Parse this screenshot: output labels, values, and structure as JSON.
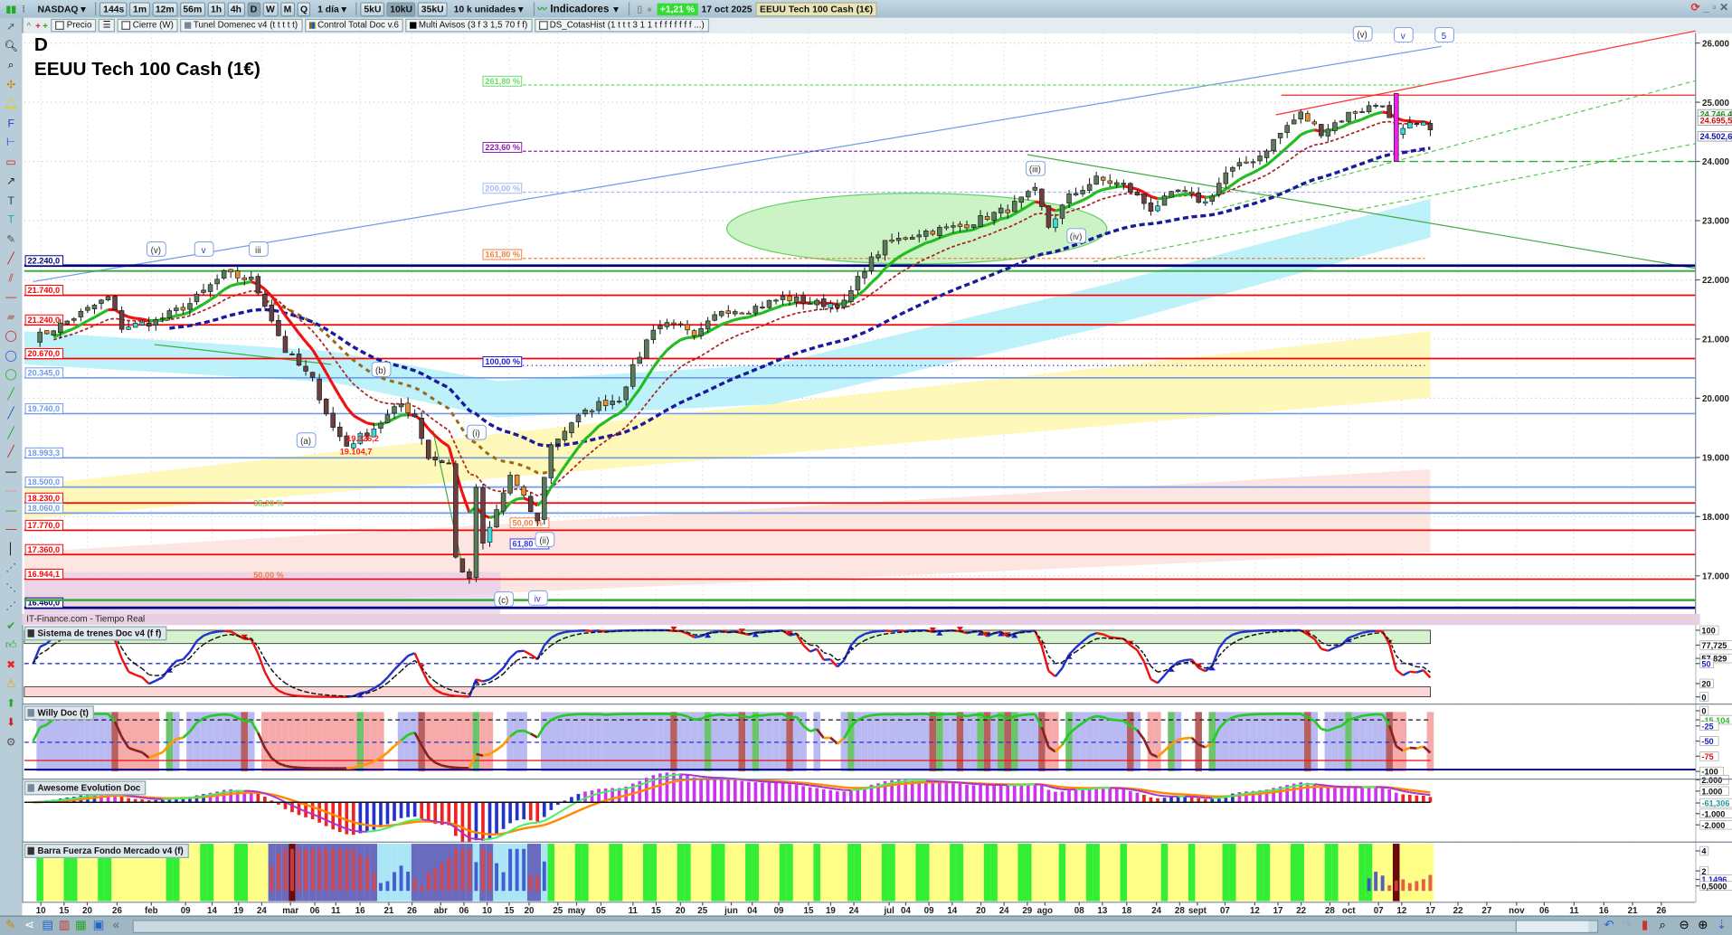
{
  "toolbar": {
    "market": "NASDAQ",
    "timeframes": [
      "144s",
      "1m",
      "12m",
      "56m",
      "1h",
      "4h",
      "D",
      "W",
      "M",
      "Q"
    ],
    "active_timeframe": "D",
    "period": "1 día",
    "units": [
      "5kU",
      "10kU",
      "35kU"
    ],
    "active_unit": "10kU",
    "unit_select": "10 k unidades",
    "indicators_label": "Indicadores",
    "change": "+1,21 %",
    "date": "17 oct 2025",
    "instrument": "EEUU Tech 100 Cash (1€)"
  },
  "indicator_bar": [
    "Precio",
    "Cierre (W)",
    "Tunel Domenec v4 (t t t t t)",
    "Control Total Doc v.6",
    "Multi Avisos (3 f 3 1,5 70 f f)",
    "DS_CotasHist (1 t t t 3 1 1 t f f f f f f f ...)"
  ],
  "chart": {
    "period_letter": "D",
    "title": "EEUU Tech 100 Cash (1€)",
    "source": "IT-Finance.com - Tiempo Real",
    "price_axis": [
      "26.000",
      "25.000",
      "24.000",
      "23.000",
      "22.000",
      "21.000",
      "20.000",
      "19.000",
      "18.000",
      "17.000"
    ],
    "price_axis_values": [
      26000,
      25000,
      24000,
      23000,
      22000,
      21000,
      20000,
      19000,
      18000,
      17000
    ],
    "current_prices": [
      {
        "text": "24.746,4",
        "price": 24746,
        "color": "#1a8a1a"
      },
      {
        "text": "24.695,5",
        "price": 24695,
        "color": "#d01010"
      },
      {
        "text": "24.502,6",
        "price": 24502,
        "color": "#1010b0"
      }
    ],
    "levels": [
      {
        "text": "22.240,0",
        "price": 22240,
        "color": "#000080"
      },
      {
        "text": "21.740,0",
        "price": 21740,
        "color": "#ff0000"
      },
      {
        "text": "21.240,0",
        "price": 21240,
        "color": "#ff0000"
      },
      {
        "text": "20.670,0",
        "price": 20670,
        "color": "#ff0000"
      },
      {
        "text": "20.345,0",
        "price": 20345,
        "color": "#6f9be8"
      },
      {
        "text": "19.740,0",
        "price": 19740,
        "color": "#6f9be8"
      },
      {
        "text": "18.993,3",
        "price": 18993,
        "color": "#6f9be8"
      },
      {
        "text": "18.500,0",
        "price": 18500,
        "color": "#6f9be8"
      },
      {
        "text": "18.230,0",
        "price": 18230,
        "color": "#ff0000"
      },
      {
        "text": "18.060,0",
        "price": 18060,
        "color": "#6f9be8"
      },
      {
        "text": "17.770,0",
        "price": 17770,
        "color": "#ff0000"
      },
      {
        "text": "17.360,0",
        "price": 17360,
        "color": "#ff0000"
      },
      {
        "text": "16.944,1",
        "price": 16944,
        "color": "#ff0000"
      },
      {
        "text": "16.460,0",
        "price": 16460,
        "color": "#000080"
      }
    ],
    "fib_labels": [
      {
        "text": "261,80 %",
        "day": 66,
        "price": 25347,
        "color": "#66dd66"
      },
      {
        "text": "223,60 %",
        "day": 66,
        "price": 24228,
        "color": "#8a20b0"
      },
      {
        "text": "200,00 %",
        "day": 66,
        "price": 23537,
        "color": "#a8b8f0"
      },
      {
        "text": "161,80 %",
        "day": 66,
        "price": 22418,
        "color": "#f08040"
      },
      {
        "text": "100,00 %",
        "day": 66,
        "price": 20608,
        "color": "#1a1ae0"
      },
      {
        "text": "50,00 %",
        "day": 70,
        "price": 17884,
        "color": "#f08040"
      },
      {
        "text": "61,80 %",
        "day": 70,
        "price": 17530,
        "color": "#3a3ae0"
      },
      {
        "text": "38,20 %",
        "day": 32,
        "price": 18220,
        "color": "#88cc66"
      },
      {
        "text": "50,00 %",
        "day": 32,
        "price": 17007,
        "color": "#f08040"
      }
    ],
    "price_notes": [
      {
        "text": "19.326,2",
        "day": 46,
        "price": 19326,
        "color": "#ff2020"
      },
      {
        "text": "19.104,7",
        "day": 45,
        "price": 19104,
        "color": "#ff2020"
      }
    ],
    "wave_labels": [
      {
        "text": "(v)",
        "day": 18,
        "price": 22510
      },
      {
        "text": "v",
        "day": 25,
        "price": 22510
      },
      {
        "text": "iii",
        "day": 33,
        "price": 22510
      },
      {
        "text": "(a)",
        "day": 40,
        "price": 19284
      },
      {
        "text": "(b)",
        "day": 51,
        "price": 20478
      },
      {
        "text": "(i)",
        "day": 65,
        "price": 19414
      },
      {
        "text": "(ii)",
        "day": 75,
        "price": 17604
      },
      {
        "text": "(c)",
        "day": 69,
        "price": 16597
      },
      {
        "text": "iv",
        "day": 74,
        "price": 16616
      },
      {
        "text": "(iii)",
        "day": 147,
        "price": 23873
      },
      {
        "text": "(iv)",
        "day": 153,
        "price": 22735
      },
      {
        "text": "(v)",
        "day": 195,
        "price": 26149
      },
      {
        "text": "v",
        "day": 201,
        "price": 26130
      },
      {
        "text": "5",
        "day": 207,
        "price": 26130
      }
    ],
    "price_path": [
      [
        0,
        21000
      ],
      [
        5,
        21300
      ],
      [
        11,
        21700
      ],
      [
        13,
        21200
      ],
      [
        18,
        21300
      ],
      [
        23,
        21600
      ],
      [
        28,
        22100
      ],
      [
        32,
        22000
      ],
      [
        34,
        21600
      ],
      [
        37,
        20800
      ],
      [
        41,
        20300
      ],
      [
        44,
        19500
      ],
      [
        46,
        19200
      ],
      [
        50,
        19500
      ],
      [
        54,
        19900
      ],
      [
        56,
        19700
      ],
      [
        58,
        19000
      ],
      [
        61,
        18900
      ],
      [
        62,
        17300
      ],
      [
        64,
        16900
      ],
      [
        65,
        18500
      ],
      [
        66,
        17500
      ],
      [
        70,
        18700
      ],
      [
        72,
        18300
      ],
      [
        74,
        17900
      ],
      [
        75,
        18700
      ],
      [
        76,
        19200
      ],
      [
        79,
        19600
      ],
      [
        83,
        19900
      ],
      [
        86,
        20000
      ],
      [
        88,
        20500
      ],
      [
        91,
        21200
      ],
      [
        94,
        21300
      ],
      [
        97,
        21000
      ],
      [
        101,
        21500
      ],
      [
        105,
        21500
      ],
      [
        110,
        21700
      ],
      [
        115,
        21600
      ],
      [
        119,
        21600
      ],
      [
        122,
        22200
      ],
      [
        125,
        22600
      ],
      [
        130,
        22800
      ],
      [
        136,
        22900
      ],
      [
        143,
        23200
      ],
      [
        147,
        23500
      ],
      [
        149,
        22900
      ],
      [
        152,
        23400
      ],
      [
        156,
        23700
      ],
      [
        160,
        23600
      ],
      [
        164,
        23200
      ],
      [
        168,
        23500
      ],
      [
        172,
        23300
      ],
      [
        175,
        23800
      ],
      [
        180,
        24100
      ],
      [
        184,
        24600
      ],
      [
        186,
        24800
      ],
      [
        189,
        24500
      ],
      [
        193,
        24800
      ],
      [
        198,
        25000
      ],
      [
        200,
        24400
      ],
      [
        202,
        24600
      ],
      [
        205,
        24600
      ]
    ]
  },
  "panes": [
    {
      "title": "Sistema de trenes Doc v4 (f f)",
      "axis": [
        "100",
        "77,725",
        "57,829",
        "50",
        "20",
        "0"
      ],
      "axis_values": [
        100,
        77.7,
        57.8,
        50,
        20,
        0
      ]
    },
    {
      "title": "Willy Doc (t)",
      "axis": [
        "0",
        "-15,104",
        "-25",
        "-50",
        "-75",
        "-100"
      ],
      "axis_values": [
        0,
        -15,
        -25,
        -50,
        -75,
        -100
      ]
    },
    {
      "title": "Awesome Evolution Doc",
      "axis": [
        "2.000",
        "1.000",
        "-61,306",
        "-1.000",
        "-2.000"
      ],
      "axis_values": [
        2,
        1,
        -0.06,
        -1,
        -2
      ]
    },
    {
      "title": "Barra Fuerza Fondo Mercado v4 (f)",
      "axis": [
        "4",
        "2",
        "1,1496",
        "0,5000"
      ],
      "axis_values": [
        4,
        2,
        1.15,
        0.5
      ]
    }
  ],
  "date_axis": [
    "10",
    "15",
    "20",
    "26",
    "feb",
    "09",
    "14",
    "19",
    "24",
    "mar",
    "06",
    "11",
    "16",
    "21",
    "26",
    "abr",
    "06",
    "10",
    "15",
    "20",
    "25",
    "may",
    "05",
    "11",
    "15",
    "20",
    "25",
    "jun",
    "04",
    "09",
    "15",
    "19",
    "24",
    "jul",
    "04",
    "09",
    "14",
    "20",
    "24",
    "29",
    "ago",
    "08",
    "13",
    "18",
    "24",
    "28",
    "sept",
    "07",
    "12",
    "17",
    "22",
    "28",
    "oct",
    "07",
    "12",
    "17",
    "22",
    "27",
    "nov",
    "06",
    "11",
    "16",
    "21",
    "26"
  ],
  "colors": {
    "up": "#33dddd",
    "down": "#e8902a",
    "fast_up": "#22bb22",
    "fast_down": "#ee1111",
    "slow": "#1a1a9a"
  }
}
